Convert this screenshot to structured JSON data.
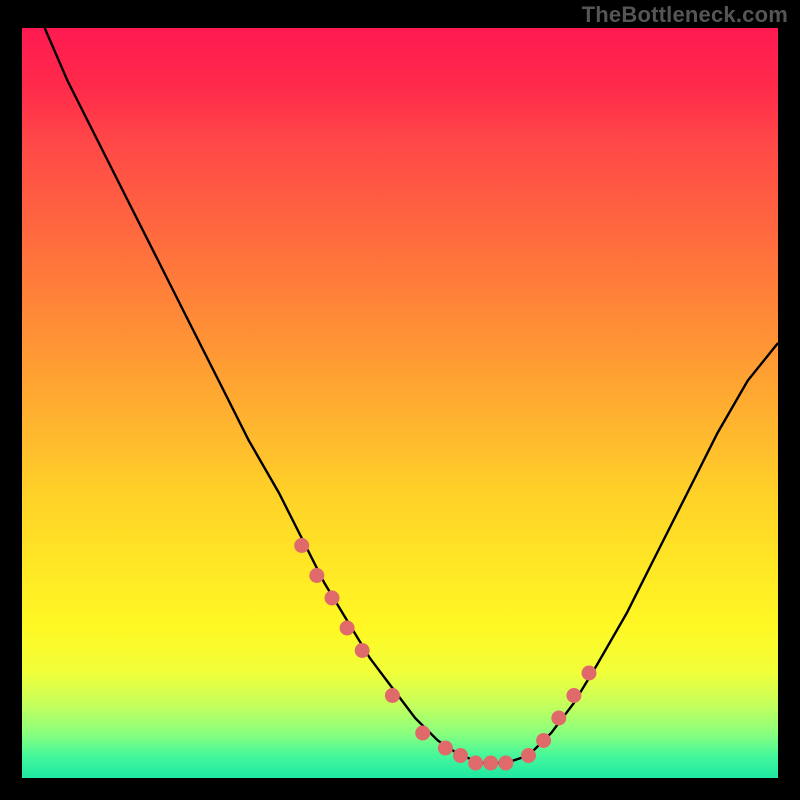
{
  "watermark": "TheBottleneck.com",
  "colors": {
    "background": "#000000",
    "gradient_top": "#ff1a52",
    "gradient_bottom": "#1de8a3",
    "curve_stroke": "#000000",
    "marker_fill": "#e06a6a",
    "marker_stroke": "#d85a5a"
  },
  "chart_data": {
    "type": "line",
    "title": "",
    "xlabel": "",
    "ylabel": "",
    "xlim": [
      0,
      100
    ],
    "ylim": [
      0,
      100
    ],
    "x": [
      3,
      6,
      10,
      14,
      18,
      22,
      26,
      30,
      34,
      37,
      40,
      43,
      46,
      49,
      52,
      55,
      58,
      61,
      64,
      67,
      70,
      73,
      76,
      80,
      84,
      88,
      92,
      96,
      100
    ],
    "y": [
      100,
      93,
      85,
      77,
      69,
      61,
      53,
      45,
      38,
      32,
      26,
      21,
      16,
      12,
      8,
      5,
      3,
      2,
      2,
      3,
      6,
      10,
      15,
      22,
      30,
      38,
      46,
      53,
      58
    ],
    "markers": {
      "x": [
        37,
        39,
        41,
        43,
        45,
        49,
        53,
        56,
        58,
        60,
        62,
        64,
        67,
        69,
        71,
        73,
        75
      ],
      "y": [
        31,
        27,
        24,
        20,
        17,
        11,
        6,
        4,
        3,
        2,
        2,
        2,
        3,
        5,
        8,
        11,
        14
      ]
    }
  }
}
